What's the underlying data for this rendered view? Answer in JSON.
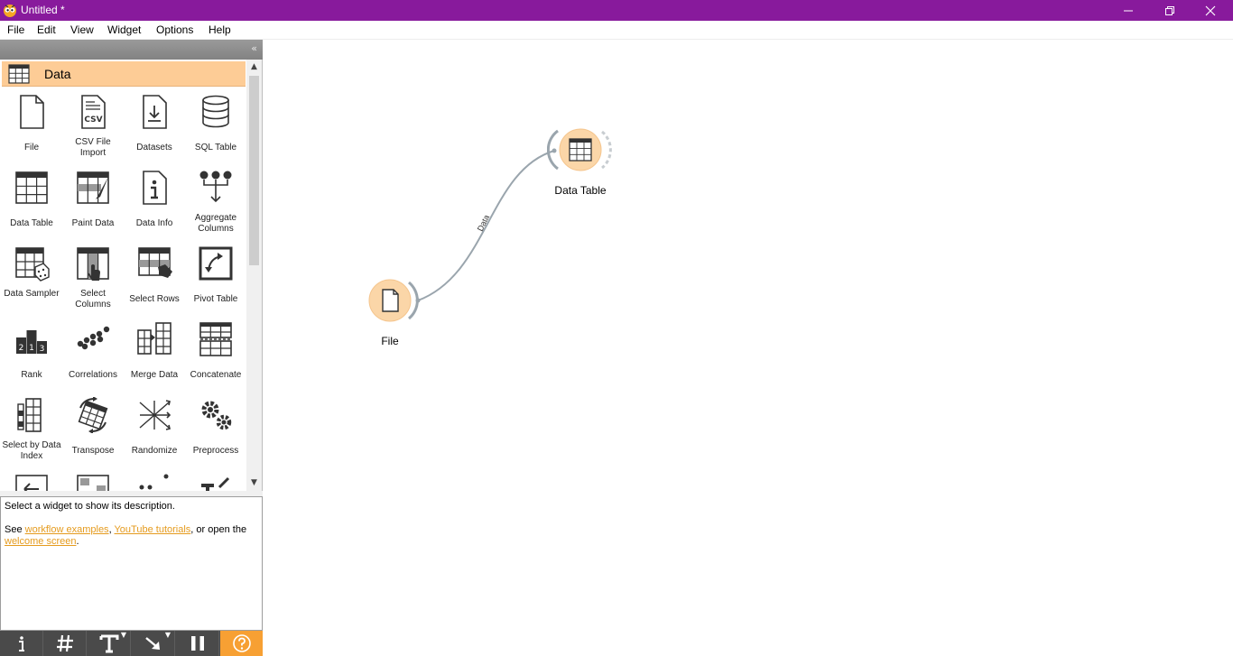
{
  "window": {
    "title": "Untitled *",
    "title_bar_color": "#881a9c"
  },
  "menu": {
    "items": [
      "File",
      "Edit",
      "View",
      "Widget",
      "Options",
      "Help"
    ]
  },
  "toolbox": {
    "category": {
      "label": "Data",
      "color": "#fdcc96",
      "icon": "table-icon"
    },
    "widgets": [
      {
        "label": "File",
        "icon": "file-icon"
      },
      {
        "label": "CSV File Import",
        "icon": "csv-file-icon"
      },
      {
        "label": "Datasets",
        "icon": "datasets-icon"
      },
      {
        "label": "SQL Table",
        "icon": "database-icon"
      },
      {
        "label": "Data Table",
        "icon": "table-icon"
      },
      {
        "label": "Paint Data",
        "icon": "paint-data-icon"
      },
      {
        "label": "Data Info",
        "icon": "info-icon"
      },
      {
        "label": "Aggregate Columns",
        "icon": "aggregate-icon"
      },
      {
        "label": "Data Sampler",
        "icon": "dice-icon"
      },
      {
        "label": "Select Columns",
        "icon": "select-columns-icon"
      },
      {
        "label": "Select Rows",
        "icon": "select-rows-icon"
      },
      {
        "label": "Pivot Table",
        "icon": "pivot-icon"
      },
      {
        "label": "Rank",
        "icon": "podium-icon"
      },
      {
        "label": "Correlations",
        "icon": "scatter-dots-icon"
      },
      {
        "label": "Merge Data",
        "icon": "merge-icon"
      },
      {
        "label": "Concatenate",
        "icon": "concatenate-icon"
      },
      {
        "label": "Select by Data Index",
        "icon": "select-by-index-icon"
      },
      {
        "label": "Transpose",
        "icon": "transpose-icon"
      },
      {
        "label": "Randomize",
        "icon": "randomize-icon"
      },
      {
        "label": "Preprocess",
        "icon": "gears-icon"
      }
    ]
  },
  "description": {
    "intro": "Select a widget to show its description.",
    "see_prefix": "See ",
    "link_workflow": "workflow examples",
    "comma": ", ",
    "link_youtube": "YouTube tutorials",
    "open_text": ", or open the",
    "link_welcome": "welcome screen",
    "period": "."
  },
  "dock_toolbar": {
    "buttons": [
      "info-icon",
      "grid-icon",
      "text-annotation-icon",
      "arrow-annotation-icon",
      "pause-icon",
      "help-icon"
    ],
    "highlight_color": "#f7a033"
  },
  "canvas": {
    "nodes": [
      {
        "label": "File",
        "icon": "file-icon"
      },
      {
        "label": "Data Table",
        "icon": "table-icon"
      }
    ],
    "link_label": "Data",
    "node_color": "#fbd6a8"
  }
}
